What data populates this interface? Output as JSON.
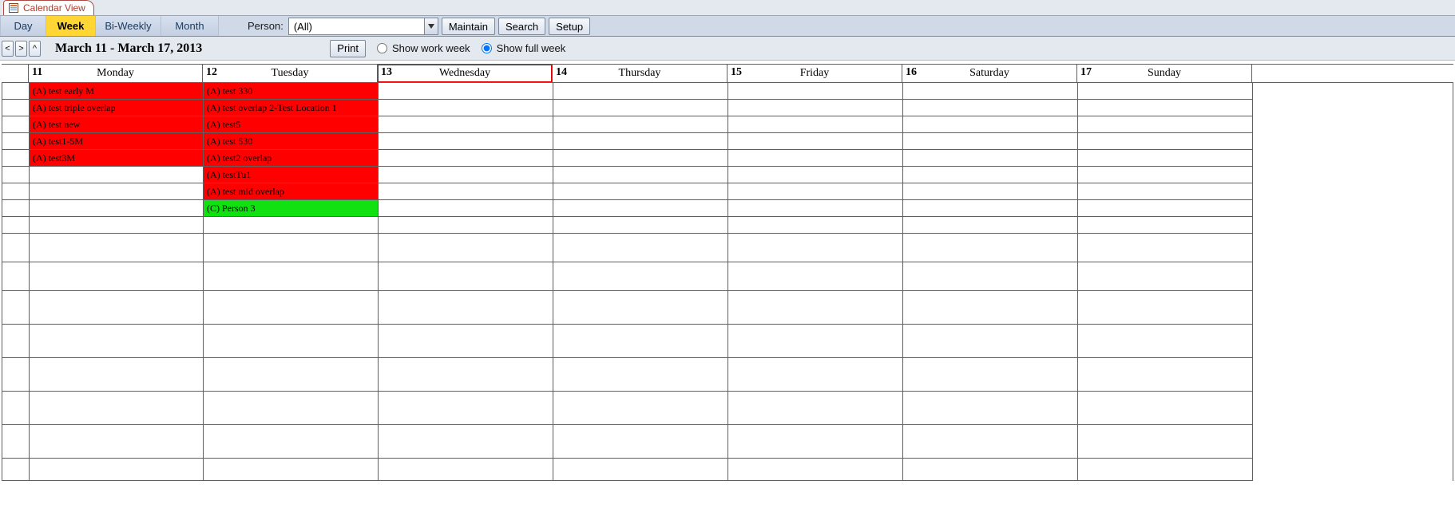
{
  "tab": {
    "title": "Calendar View"
  },
  "toolbar": {
    "views": {
      "day": "Day",
      "week": "Week",
      "biweekly": "Bi-Weekly",
      "month": "Month",
      "active": "week"
    },
    "person_label": "Person:",
    "person_value": "(All)",
    "maintain": "Maintain",
    "search": "Search",
    "setup": "Setup"
  },
  "nav": {
    "prev": "<",
    "next": ">",
    "up": "^",
    "date_range": "March 11 - March 17, 2013",
    "print": "Print",
    "radio_work": "Show work week",
    "radio_full": "Show full week",
    "radio_selected": "full"
  },
  "days": [
    {
      "num": "11",
      "name": "Monday"
    },
    {
      "num": "12",
      "name": "Tuesday"
    },
    {
      "num": "13",
      "name": "Wednesday"
    },
    {
      "num": "14",
      "name": "Thursday"
    },
    {
      "num": "15",
      "name": "Friday"
    },
    {
      "num": "16",
      "name": "Saturday"
    },
    {
      "num": "17",
      "name": "Sunday"
    }
  ],
  "events": {
    "monday": [
      {
        "text": "(A) test early M",
        "color": "red"
      },
      {
        "text": "(A) test triple overlap",
        "color": "red"
      },
      {
        "text": "(A) test new",
        "color": "red"
      },
      {
        "text": "(A) test1-5M",
        "color": "red"
      },
      {
        "text": "(A) test3M",
        "color": "red"
      }
    ],
    "tuesday": [
      {
        "text": "(A) test 330",
        "color": "red"
      },
      {
        "text": "(A) test overlap 2-Test Location 1",
        "color": "red"
      },
      {
        "text": "(A) test5",
        "color": "red"
      },
      {
        "text": "(A) test 530",
        "color": "red"
      },
      {
        "text": "(A) test2 overlap",
        "color": "red"
      },
      {
        "text": "(A) testTu1",
        "color": "red"
      },
      {
        "text": "(A) test mid overlap",
        "color": "red"
      },
      {
        "text": "(C) Person 3",
        "color": "green"
      }
    ]
  },
  "colors": {
    "event_red": "#ff0000",
    "event_green": "#11e011",
    "toolbar_active": "#ffd633"
  }
}
